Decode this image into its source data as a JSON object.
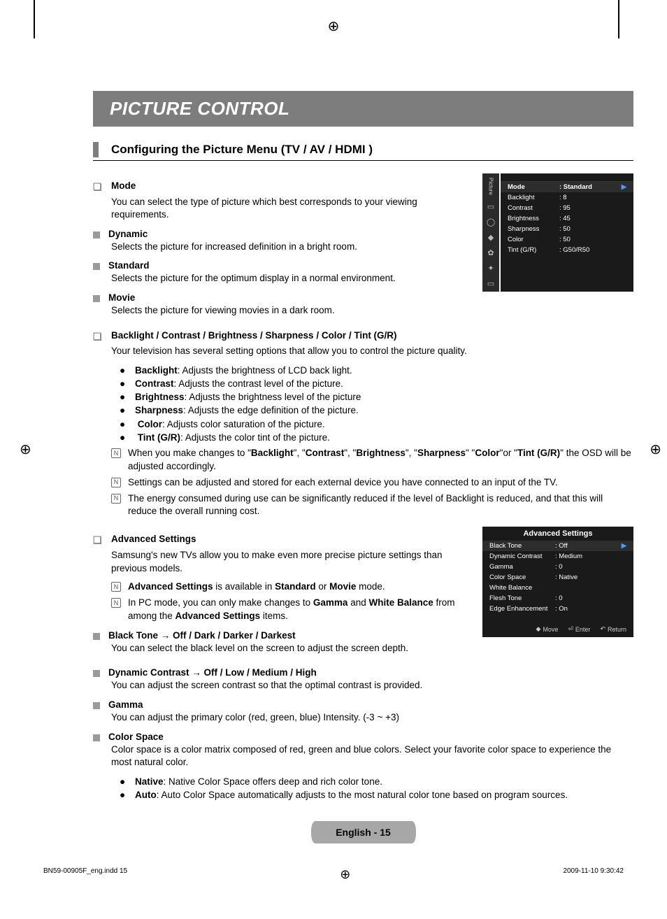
{
  "title_bar": "PICTURE CONTROL",
  "section_title": "Configuring the Picture Menu (TV / AV / HDMI )",
  "mode": {
    "heading": "Mode",
    "intro": "You can select the type of picture which best corresponds to your viewing requirements.",
    "dynamic": {
      "label": "Dynamic",
      "desc": "Selects the picture for increased definition in a bright room."
    },
    "standard": {
      "label": "Standard",
      "desc": "Selects the picture for the optimum display in a normal environment."
    },
    "movie": {
      "label": "Movie",
      "desc": "Selects the picture for viewing movies in a dark room."
    }
  },
  "osd_picture": {
    "side_label": "Picture",
    "rows": [
      {
        "label": "Mode",
        "value": ": Standard",
        "selected": true
      },
      {
        "label": "Backlight",
        "value": ": 8"
      },
      {
        "label": "Contrast",
        "value": ": 95"
      },
      {
        "label": "Brightness",
        "value": ": 45"
      },
      {
        "label": "Sharpness",
        "value": ": 50"
      },
      {
        "label": "Color",
        "value": ": 50"
      },
      {
        "label": "Tint (G/R)",
        "value": ": G50/R50"
      }
    ]
  },
  "bl_section": {
    "heading": "Backlight / Contrast / Brightness / Sharpness / Color / Tint (G/R)",
    "intro": "Your television has several setting options that allow you to control the picture quality.",
    "bullets": {
      "backlight": {
        "b": "Backlight",
        "t": ": Adjusts the brightness of LCD back light."
      },
      "contrast": {
        "b": "Contrast",
        "t": ": Adjusts the contrast level of the picture."
      },
      "brightness": {
        "b": "Brightness",
        "t": ": Adjusts the brightness level of the picture"
      },
      "sharpness": {
        "b": "Sharpness",
        "t": ": Adjusts the edge definition of the picture."
      },
      "color": {
        "b": "Color",
        "t": ": Adjusts color saturation of the picture."
      },
      "tint": {
        "b": "Tint (G/R)",
        "t": ": Adjusts the color tint of the picture."
      }
    },
    "note1": {
      "pre": "When you make changes to \"",
      "b1": "Backlight",
      "m1": "\", \"",
      "b2": "Contrast",
      "m2": "\", \"",
      "b3": "Brightness",
      "m3": "\", \"",
      "b4": "Sharpness",
      "m4": "\" \"",
      "b5": "Color",
      "m5": "\"or \"",
      "b6": "Tint (G/R)",
      "post": "\" the OSD will be adjusted accordingly."
    },
    "note2": "Settings can be adjusted and stored for each external device you have connected to an input of the TV.",
    "note3": "The energy consumed during use can be significantly reduced if the level of Backlight is reduced, and that this will reduce the overall running cost."
  },
  "adv": {
    "heading": "Advanced Settings",
    "intro": "Samsung's new TVs allow you to make even more precise picture settings than previous models.",
    "note1": {
      "b1": "Advanced Settings",
      "m1": " is available in ",
      "b2": "Standard",
      "m2": " or ",
      "b3": "Movie",
      "post": " mode."
    },
    "note2": {
      "pre": "In PC mode, you can only make changes to ",
      "b1": "Gamma",
      "m1": " and ",
      "b2": "White Balance",
      "m2": " from among the ",
      "b3": "Advanced Settings",
      "post": " items."
    },
    "blacktone": {
      "label": "Black Tone → Off / Dark / Darker / Darkest",
      "desc": "You can select the black level on the screen to adjust the screen depth."
    },
    "dyncon": {
      "label": "Dynamic Contrast → Off / Low / Medium / High",
      "desc": "You can adjust the screen contrast so that the optimal contrast is provided."
    },
    "gamma": {
      "label": "Gamma",
      "desc": "You can adjust the primary color (red, green, blue) Intensity. (-3 ~ +3)"
    },
    "cspace": {
      "label": "Color Space",
      "desc": "Color space is a color matrix composed of red, green and blue colors. Select your favorite color space to experience the most natural color.",
      "native": {
        "b": "Native",
        "t": ": Native Color Space offers deep and rich color tone."
      },
      "auto": {
        "b": "Auto",
        "t": ": Auto Color Space automatically adjusts to the most natural color tone based on program sources."
      }
    }
  },
  "osd_adv": {
    "title": "Advanced Settings",
    "rows": [
      {
        "label": "Black Tone",
        "value": ": Off",
        "selected": true
      },
      {
        "label": "Dynamic Contrast",
        "value": ": Medium"
      },
      {
        "label": "Gamma",
        "value": ": 0"
      },
      {
        "label": "Color Space",
        "value": ": Native"
      },
      {
        "label": "White Balance",
        "value": ""
      },
      {
        "label": "Flesh Tone",
        "value": ": 0"
      },
      {
        "label": "Edge Enhancement",
        "value": ": On"
      }
    ],
    "foot": {
      "move": "Move",
      "enter": "Enter",
      "return": "Return"
    }
  },
  "page_badge": "English - 15",
  "footer": {
    "left": "BN59-00905F_eng.indd   15",
    "right": "2009-11-10   9:30:42"
  }
}
